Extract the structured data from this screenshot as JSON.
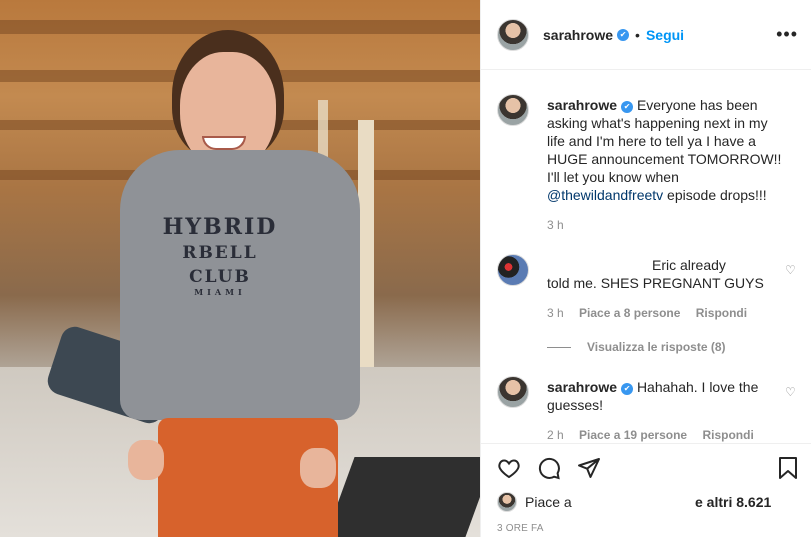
{
  "post": {
    "username": "sarahrowe",
    "dot": "•",
    "follow_label": "Segui",
    "more_icon": "more-options-icon",
    "verified_badge": "✔"
  },
  "photo": {
    "print_line1": "HYBRID",
    "print_line2": "RBELL CLUB",
    "print_line3": "MIAMI"
  },
  "caption": {
    "username": "sarahrowe",
    "text": "Everyone has been asking what's happening next in my life and I'm here to tell ya I have a HUGE announcement TOMORROW!! I'll let you know when",
    "mention": "@thewildandfreetv",
    "text_after": " episode drops!!!",
    "time": "3 h"
  },
  "comments": [
    {
      "username": "",
      "text_line1": "Eric already",
      "text_line2": "told me. SHES PREGNANT GUYS",
      "time": "3 h",
      "likes": "Piace a 8 persone",
      "reply": "Rispondi",
      "view_replies": "Visualizza le risposte (8)"
    },
    {
      "username": "sarahrowe",
      "text": "Hahahah. I love the guesses!",
      "time": "2 h",
      "likes": "Piace a 19 persone",
      "reply": "Rispondi"
    }
  ],
  "footer": {
    "likes_prefix": "Piace a",
    "likes_suffix": "e altri 8.621",
    "time": "3 ORE FA"
  },
  "icons": [
    "heart-icon",
    "comment-icon",
    "share-icon",
    "bookmark-icon"
  ]
}
